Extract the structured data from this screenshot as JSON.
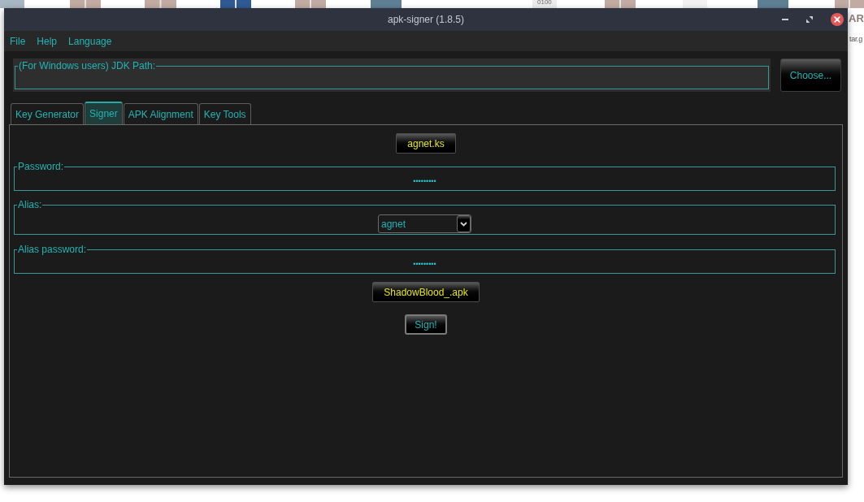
{
  "window": {
    "title": "apk-signer (1.8.5)"
  },
  "menu": [
    "File",
    "Help",
    "Language"
  ],
  "jdk_path": {
    "label": "(For Windows users) JDK Path:",
    "button": "Choose..."
  },
  "tabs": [
    {
      "label": "Key Generator",
      "selected": false
    },
    {
      "label": "Signer",
      "selected": true
    },
    {
      "label": "APK Alignment",
      "selected": false
    },
    {
      "label": "Key Tools",
      "selected": false
    }
  ],
  "signer": {
    "keystore_button": "agnet.ks",
    "password": {
      "label": "Password:",
      "value": "•••••••••"
    },
    "alias": {
      "label": "Alias:",
      "value": "agnet"
    },
    "alias_password": {
      "label": "Alias password:",
      "value": "•••••••••"
    },
    "apk_button": "ShadowBlood_.apk",
    "sign_button": "Sign!"
  },
  "desktop": {
    "icon_texts": [
      "0100",
      "AR"
    ],
    "file_labels": [
      "tar.g"
    ]
  }
}
